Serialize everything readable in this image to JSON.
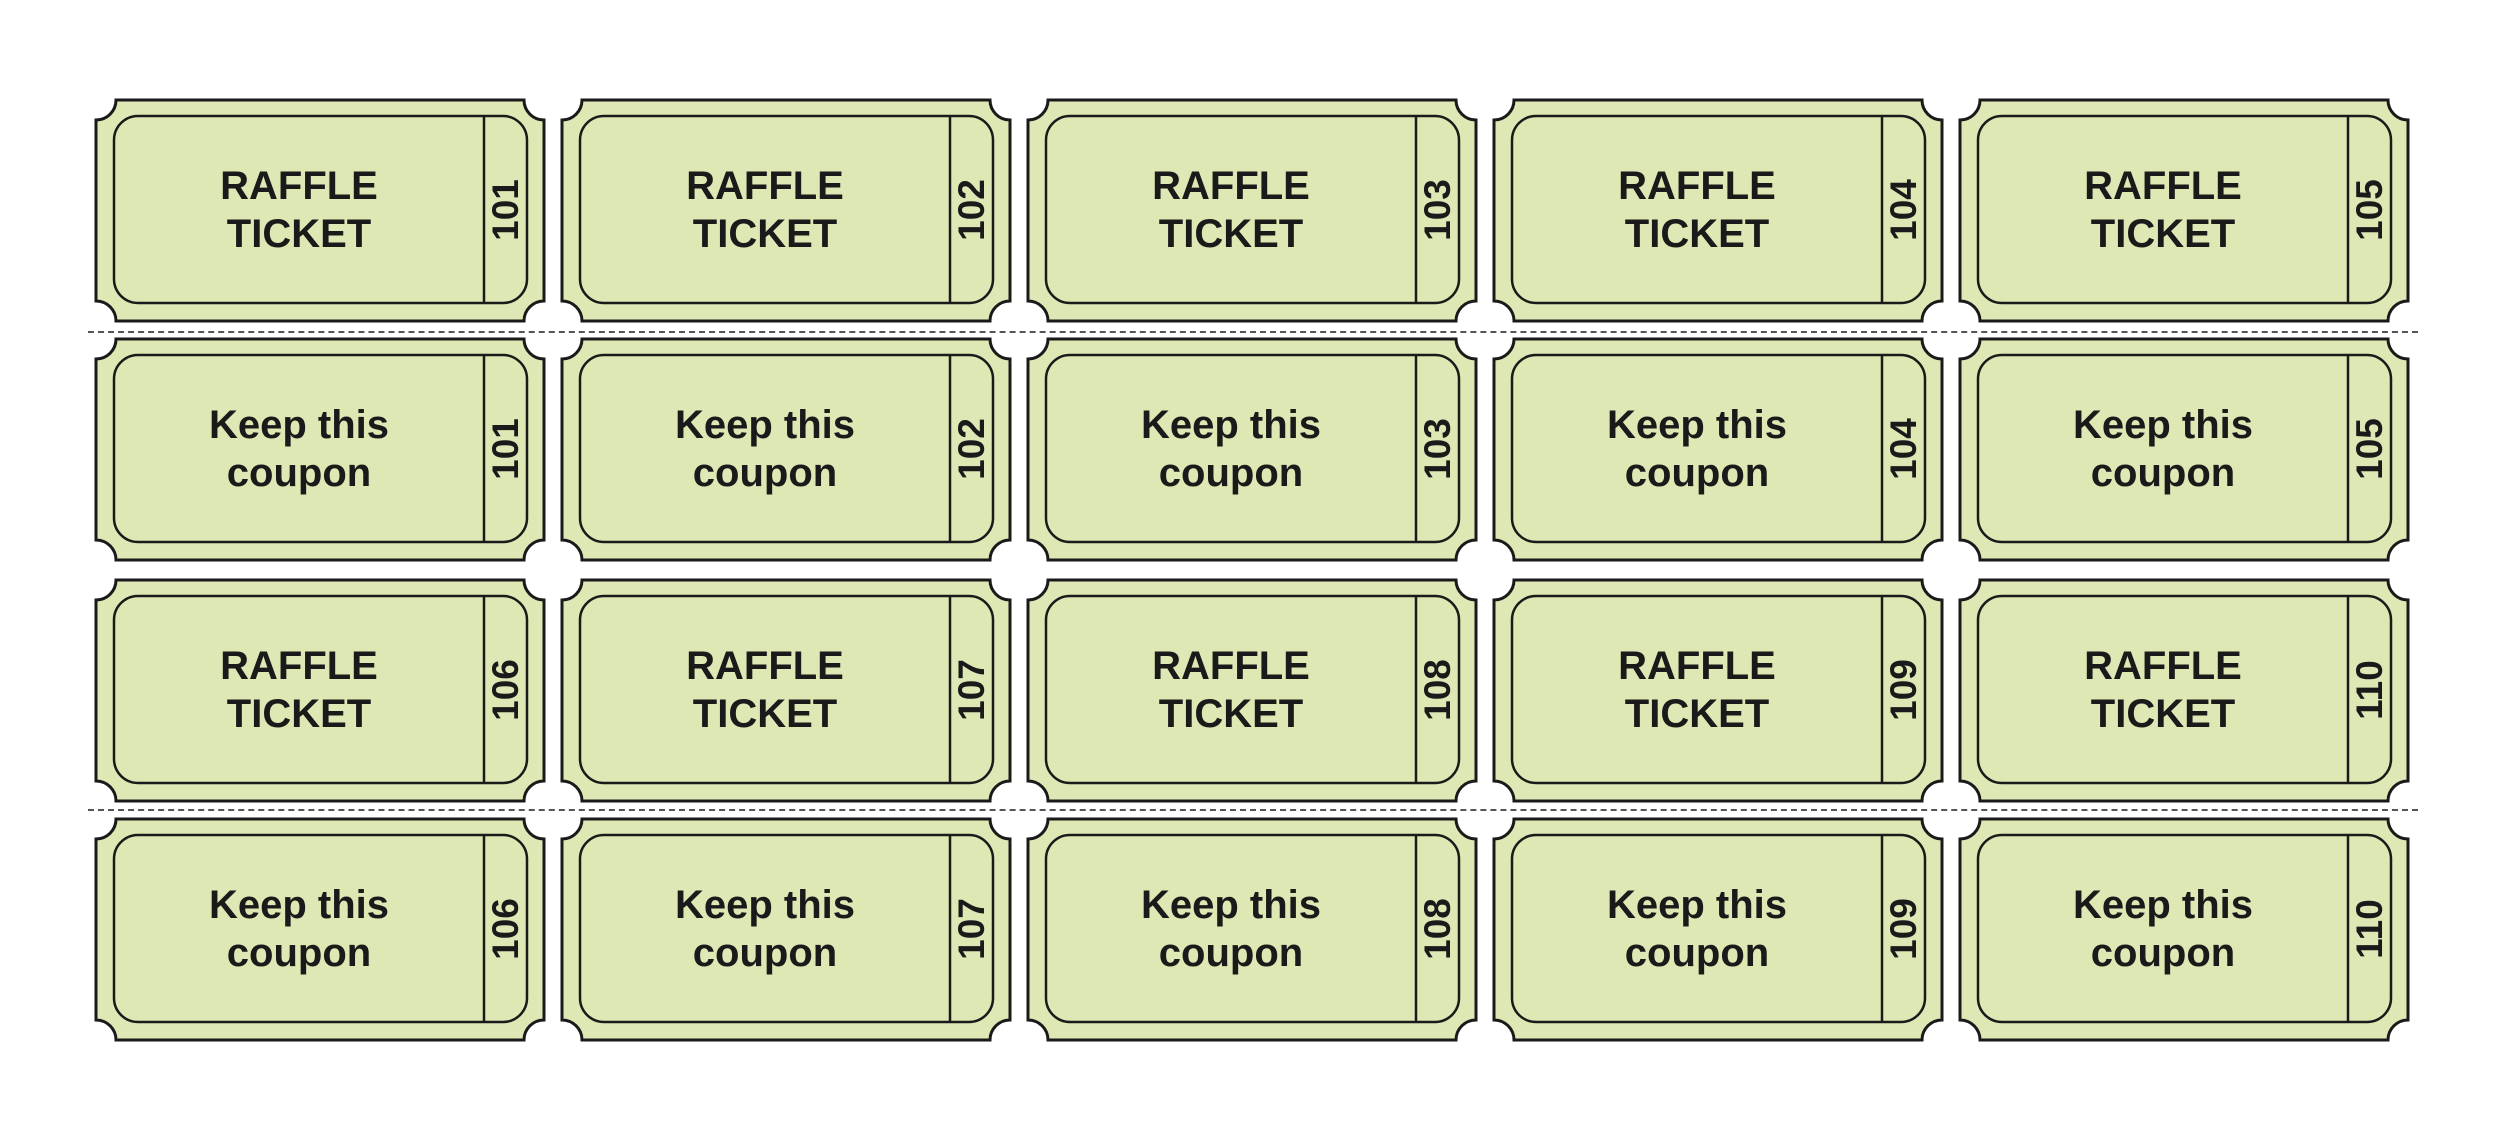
{
  "colors": {
    "ticket_fill": "#dde8b4",
    "outline": "#1a1a1a",
    "cut_line": "#555555"
  },
  "rows": [
    {
      "type": "ticket",
      "lines": [
        "RAFFLE",
        "TICKET"
      ],
      "numbers": [
        "101",
        "102",
        "103",
        "104",
        "105"
      ]
    },
    {
      "type": "coupon",
      "lines": [
        "Keep this",
        "coupon"
      ],
      "numbers": [
        "101",
        "102",
        "103",
        "104",
        "105"
      ]
    },
    {
      "type": "ticket",
      "lines": [
        "RAFFLE",
        "TICKET"
      ],
      "numbers": [
        "106",
        "107",
        "108",
        "109",
        "110"
      ]
    },
    {
      "type": "coupon",
      "lines": [
        "Keep this",
        "coupon"
      ],
      "numbers": [
        "106",
        "107",
        "108",
        "109",
        "110"
      ]
    }
  ]
}
